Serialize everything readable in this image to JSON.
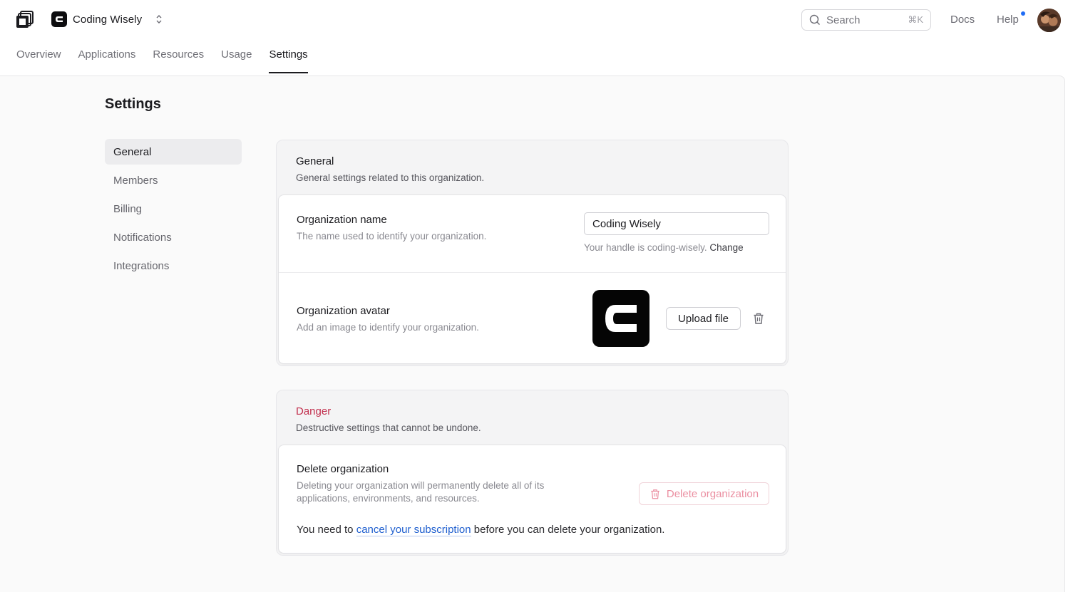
{
  "header": {
    "org_name": "Coding Wisely",
    "search_placeholder": "Search",
    "search_shortcut": "⌘K",
    "docs_label": "Docs",
    "help_label": "Help"
  },
  "tabs": [
    {
      "label": "Overview"
    },
    {
      "label": "Applications"
    },
    {
      "label": "Resources"
    },
    {
      "label": "Usage"
    },
    {
      "label": "Settings",
      "active": true
    }
  ],
  "page": {
    "title": "Settings"
  },
  "sidebar": {
    "items": [
      {
        "label": "General",
        "active": true
      },
      {
        "label": "Members"
      },
      {
        "label": "Billing"
      },
      {
        "label": "Notifications"
      },
      {
        "label": "Integrations"
      }
    ]
  },
  "general": {
    "title": "General",
    "description": "General settings related to this organization.",
    "org_name": {
      "title": "Organization name",
      "description": "The name used to identify your organization.",
      "value": "Coding Wisely",
      "handle_prefix": "Your handle is coding-wisely.",
      "change_label": "Change"
    },
    "org_avatar": {
      "title": "Organization avatar",
      "description": "Add an image to identify your organization.",
      "upload_label": "Upload file"
    }
  },
  "danger": {
    "title": "Danger",
    "description": "Destructive settings that cannot be undone.",
    "delete": {
      "title": "Delete organization",
      "description_line1": "Deleting your organization will permanently delete all of its",
      "description_line2": "applications, environments, and resources.",
      "button_label": "Delete organization",
      "note_prefix": "You need to",
      "note_link": "cancel your subscription",
      "note_suffix": "before you can delete your organization."
    }
  },
  "colors": {
    "accent_link": "#1f5fcf",
    "danger": "#c2304e",
    "notification_dot": "#1f6cf5"
  }
}
